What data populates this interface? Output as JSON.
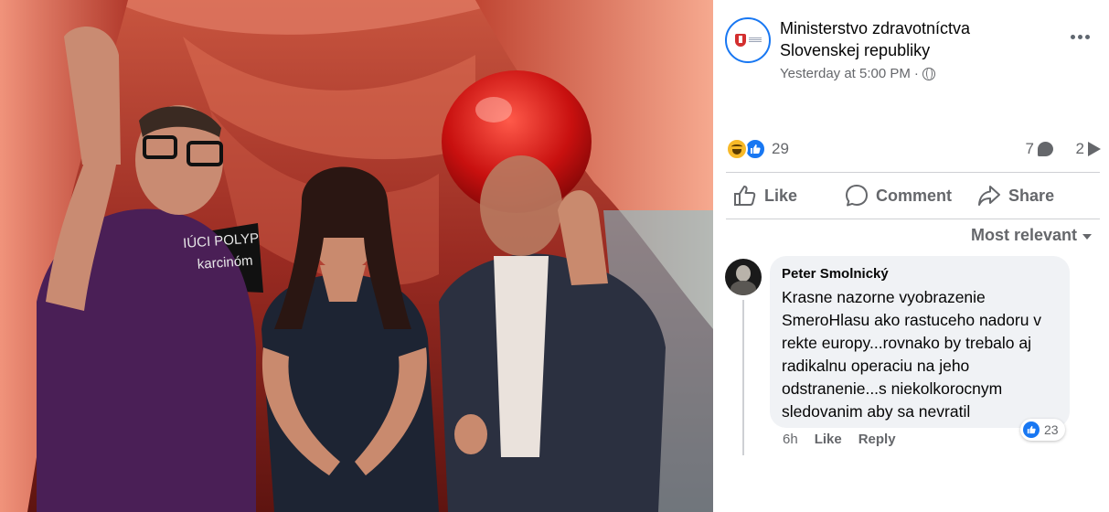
{
  "post": {
    "page_name": "Ministerstvo zdravotníctva Slovenskej republiky",
    "timestamp": "Yesterday at 5:00 PM",
    "separator": "·",
    "privacy_icon": "globe-icon",
    "more_icon": "more-options-icon"
  },
  "photo": {
    "sign_line1": "IÚCI POLYP",
    "sign_line2": "karcinóm"
  },
  "stats": {
    "reaction_icons": [
      "haha-reaction-icon",
      "like-reaction-icon"
    ],
    "reaction_count": "29",
    "comment_count": "7",
    "share_count": "2"
  },
  "actions": {
    "like": "Like",
    "comment": "Comment",
    "share": "Share"
  },
  "sort": {
    "label": "Most relevant"
  },
  "comments": [
    {
      "author": "Peter Smolnický",
      "text": "Krasne nazorne vyobrazenie SmeroHlasu ako rastuceho nadoru v rekte europy...rovnako by trebalo aj radikalnu operaciu na jeho odstranenie...s niekolkorocnym sledovanim aby sa nevratil",
      "time": "6h",
      "like_label": "Like",
      "reply_label": "Reply",
      "reaction_count": "23"
    }
  ],
  "colors": {
    "accent": "#1877f2",
    "muted_text": "#65676b",
    "bubble_bg": "#f0f2f5",
    "haha": "#f7b928"
  }
}
